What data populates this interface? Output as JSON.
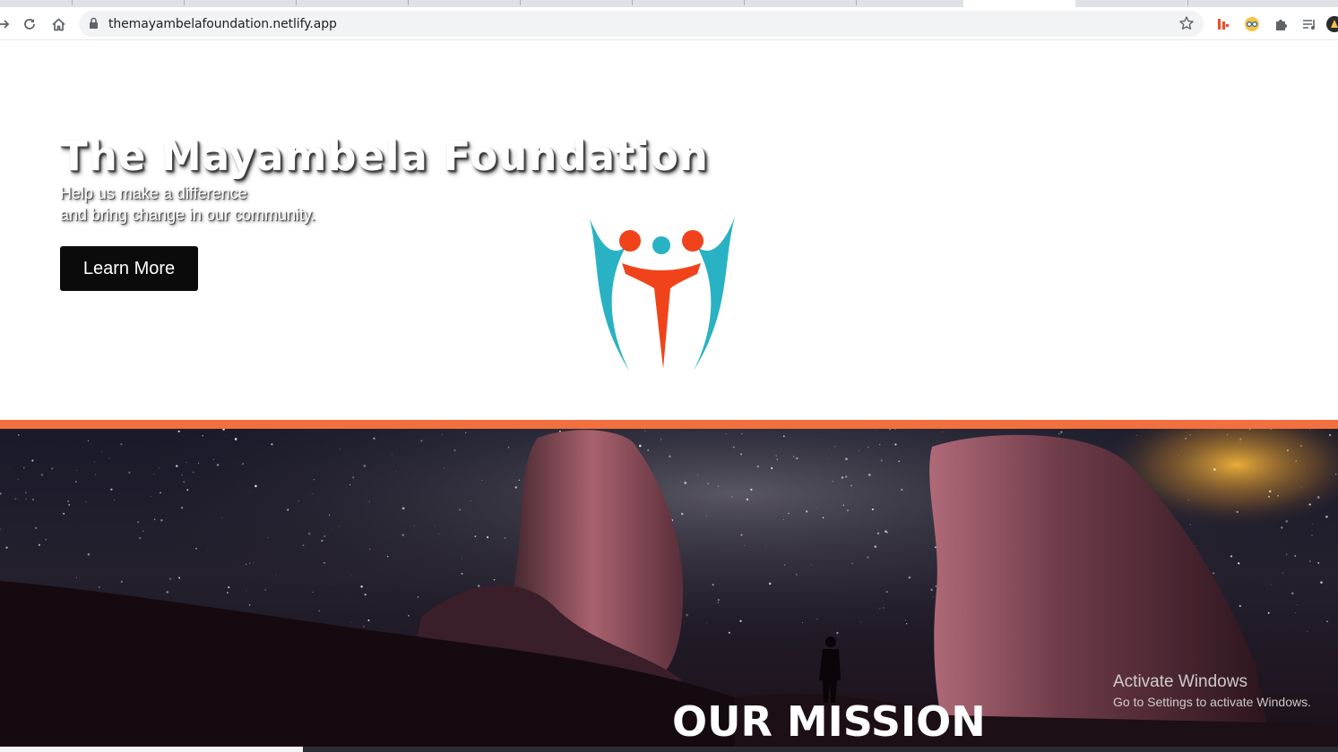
{
  "browser": {
    "url": "themayambelafoundation.netlify.app"
  },
  "hero": {
    "title": "The Mayambela Foundation",
    "subtitle_line1": "Help us make a difference",
    "subtitle_line2": "and bring change in our community.",
    "cta_label": "Learn More"
  },
  "mission": {
    "heading": "OUR MISSION"
  },
  "watermark": {
    "line1": "Activate Windows",
    "line2": "Go to Settings to activate Windows."
  },
  "colors": {
    "accent": "#f26f3f",
    "logo_teal": "#29b2c3",
    "logo_orange": "#f0431c",
    "button": "#0b0b0b"
  }
}
